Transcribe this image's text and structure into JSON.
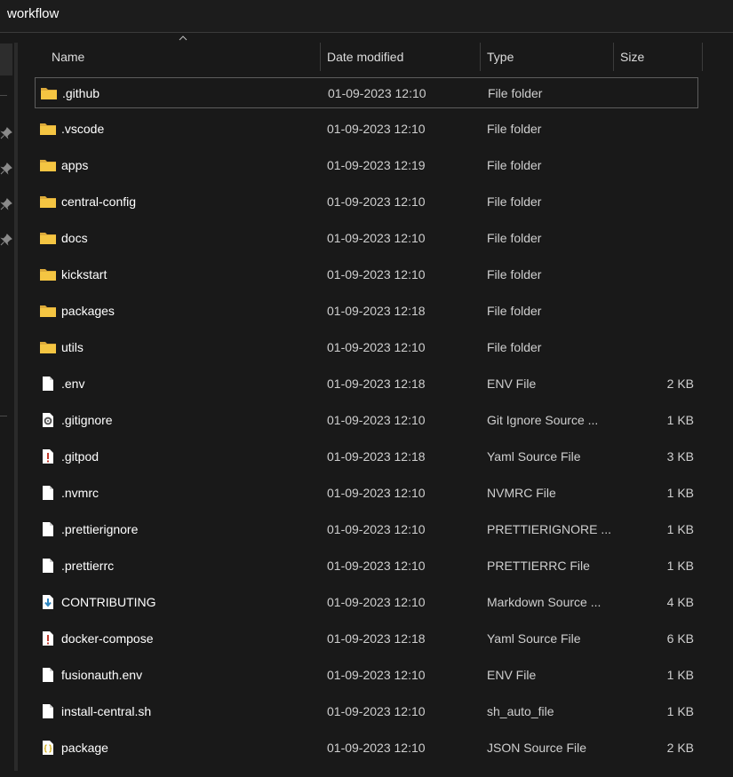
{
  "address_bar": {
    "path": "workflow"
  },
  "columns": {
    "name": "Name",
    "date": "Date modified",
    "type": "Type",
    "size": "Size"
  },
  "files": [
    {
      "name": ".github",
      "date": "01-09-2023 12:10",
      "type": "File folder",
      "size": "",
      "icon": "folder-icon"
    },
    {
      "name": ".vscode",
      "date": "01-09-2023 12:10",
      "type": "File folder",
      "size": "",
      "icon": "folder-icon"
    },
    {
      "name": "apps",
      "date": "01-09-2023 12:19",
      "type": "File folder",
      "size": "",
      "icon": "folder-icon"
    },
    {
      "name": "central-config",
      "date": "01-09-2023 12:10",
      "type": "File folder",
      "size": "",
      "icon": "folder-icon"
    },
    {
      "name": "docs",
      "date": "01-09-2023 12:10",
      "type": "File folder",
      "size": "",
      "icon": "folder-icon"
    },
    {
      "name": "kickstart",
      "date": "01-09-2023 12:10",
      "type": "File folder",
      "size": "",
      "icon": "folder-icon"
    },
    {
      "name": "packages",
      "date": "01-09-2023 12:18",
      "type": "File folder",
      "size": "",
      "icon": "folder-icon"
    },
    {
      "name": "utils",
      "date": "01-09-2023 12:10",
      "type": "File folder",
      "size": "",
      "icon": "folder-icon"
    },
    {
      "name": ".env",
      "date": "01-09-2023 12:18",
      "type": "ENV File",
      "size": "2 KB",
      "icon": "file-icon"
    },
    {
      "name": ".gitignore",
      "date": "01-09-2023 12:10",
      "type": "Git Ignore Source ...",
      "size": "1 KB",
      "icon": "gear-file-icon"
    },
    {
      "name": ".gitpod",
      "date": "01-09-2023 12:18",
      "type": "Yaml Source File",
      "size": "3 KB",
      "icon": "yaml-file-icon"
    },
    {
      "name": ".nvmrc",
      "date": "01-09-2023 12:10",
      "type": "NVMRC File",
      "size": "1 KB",
      "icon": "file-icon"
    },
    {
      "name": ".prettierignore",
      "date": "01-09-2023 12:10",
      "type": "PRETTIERIGNORE ...",
      "size": "1 KB",
      "icon": "file-icon"
    },
    {
      "name": ".prettierrc",
      "date": "01-09-2023 12:10",
      "type": "PRETTIERRC File",
      "size": "1 KB",
      "icon": "file-icon"
    },
    {
      "name": "CONTRIBUTING",
      "date": "01-09-2023 12:10",
      "type": "Markdown Source ...",
      "size": "4 KB",
      "icon": "markdown-file-icon"
    },
    {
      "name": "docker-compose",
      "date": "01-09-2023 12:18",
      "type": "Yaml Source File",
      "size": "6 KB",
      "icon": "yaml-file-icon"
    },
    {
      "name": "fusionauth.env",
      "date": "01-09-2023 12:10",
      "type": "ENV File",
      "size": "1 KB",
      "icon": "file-icon"
    },
    {
      "name": "install-central.sh",
      "date": "01-09-2023 12:10",
      "type": "sh_auto_file",
      "size": "1 KB",
      "icon": "file-icon"
    },
    {
      "name": "package",
      "date": "01-09-2023 12:10",
      "type": "JSON Source File",
      "size": "2 KB",
      "icon": "json-file-icon"
    }
  ],
  "selected_index": 0,
  "sort": {
    "column": "name",
    "direction": "ascending",
    "icon": "sort-up-icon"
  },
  "nav_pane": {
    "pin_icon": "pin-icon",
    "pinned_count": 4
  },
  "colors": {
    "background": "#191919",
    "folder": "#f4c542",
    "text": "#ffffff",
    "secondary_text": "#cfcfcf",
    "selection_border": "#5d5d5d"
  }
}
